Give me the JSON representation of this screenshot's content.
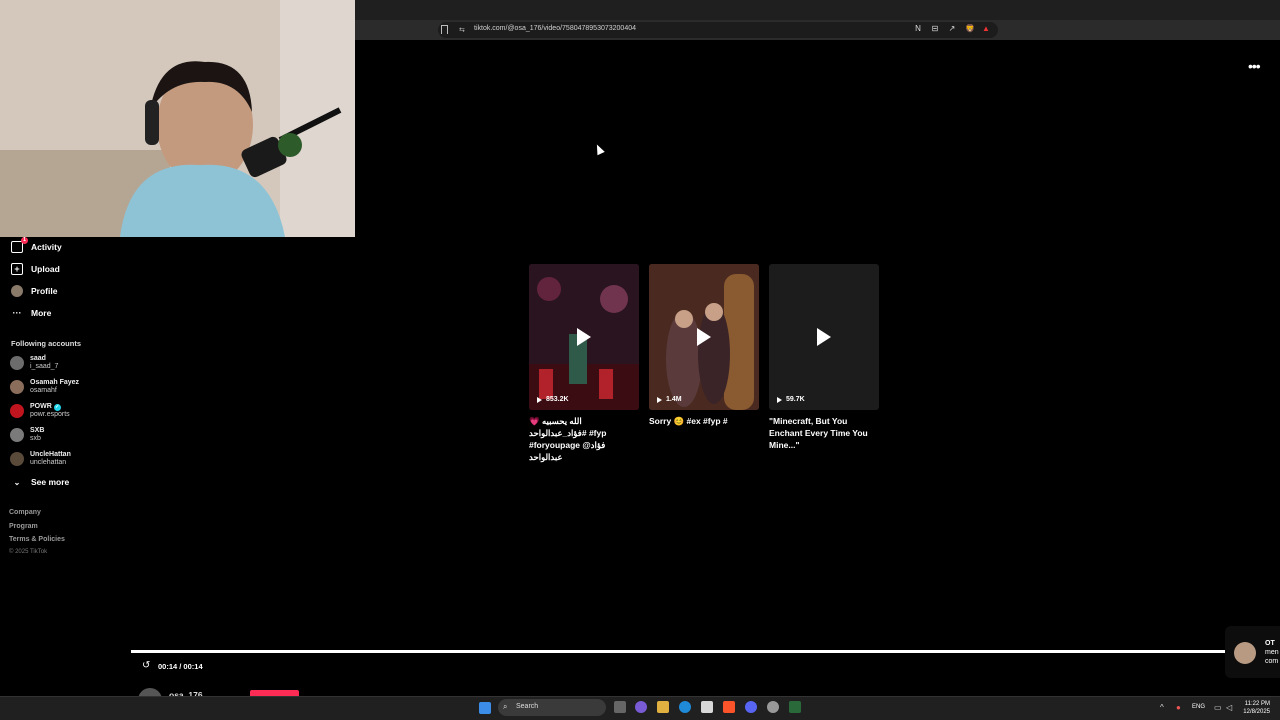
{
  "browser": {
    "url": "tiktok.com/@osa_176/video/7580478953073200404",
    "extensions": [
      "N",
      "⊟",
      "↗",
      "🦁",
      "▲"
    ]
  },
  "sidebar": {
    "nav": [
      {
        "label": "Activity",
        "icon": "activity-icon",
        "badge": "1"
      },
      {
        "label": "Upload",
        "icon": "upload-icon"
      },
      {
        "label": "Profile",
        "icon": "profile-icon"
      },
      {
        "label": "More",
        "icon": "more-icon"
      }
    ],
    "following_title": "Following accounts",
    "accounts": [
      {
        "name": "saad",
        "handle": "i_saad_7",
        "color": "#6c6c6c"
      },
      {
        "name": "Osamah Fayez",
        "handle": "osamahf",
        "color": "#8a6d5a"
      },
      {
        "name": "POWR",
        "handle": "powr.esports",
        "color": "#c0151e",
        "verified": "✓"
      },
      {
        "name": "SXB",
        "handle": "sxb",
        "color": "#7a7a7a"
      },
      {
        "name": "UncleHattan",
        "handle": "unclehattan",
        "color": "#5a4a3a"
      }
    ],
    "see_more": "See more",
    "footer": [
      "Company",
      "Program",
      "Terms & Policies"
    ],
    "copyright": "© 2025 TikTok"
  },
  "videos": [
    {
      "views": "853.2K",
      "caption": "‏الله يحسبيه 💗 #فؤاد_عبدالواحد #fyp #foryoupage @فؤاد عبدالواحد",
      "bg": "#3a1a2a"
    },
    {
      "views": "1.4M",
      "caption": "Sorry 😊 #ex #fyp #",
      "bg": "#5a3428"
    },
    {
      "views": "59.7K",
      "caption": "\"Minecraft, But You Enchant Every Time You Mine...\"",
      "bg": "#1c1c1c"
    }
  ],
  "player": {
    "time": "00:14 / 00:14",
    "progress_fraction": 1.0,
    "author": "osa_176"
  },
  "notification": {
    "line1": "OT",
    "line2": "men",
    "line3": "com"
  },
  "taskbar": {
    "search_placeholder": "Search",
    "lang": "ENG",
    "time": "11:22 PM",
    "date": "12/8/2025"
  }
}
